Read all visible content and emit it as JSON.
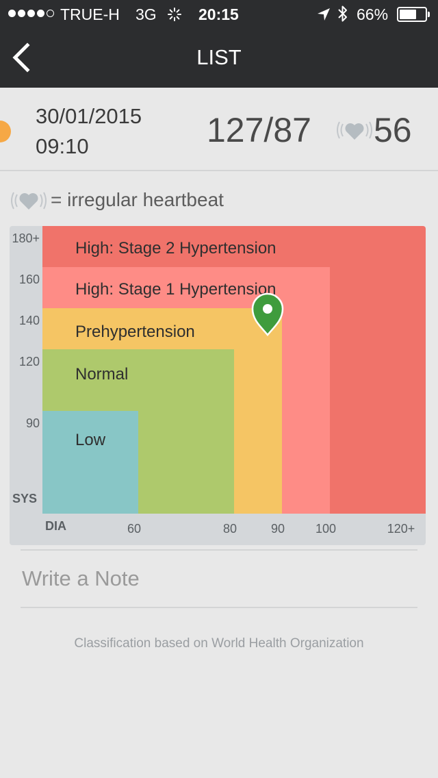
{
  "status_bar": {
    "signal_bars_filled": 4,
    "signal_bars_total": 5,
    "carrier": "TRUE-H",
    "network": "3G",
    "time": "20:15",
    "battery": "66%",
    "battery_level": 0.66,
    "icons": [
      "signal-dots-icon",
      "activity-spinner-icon",
      "location-arrow-icon",
      "bluetooth-icon",
      "battery-icon"
    ]
  },
  "nav": {
    "title": "LIST",
    "back_icon": "chevron-left-icon"
  },
  "reading": {
    "date": "30/01/2015",
    "time": "09:10",
    "blood_pressure": "127/87",
    "systolic": 127,
    "diastolic": 87,
    "heart_rate": "56",
    "category_color": "#f6a845",
    "irregular_heartbeat_icon": "heart-waves-icon"
  },
  "legend": {
    "icon": "heart-waves-icon",
    "text": "= irregular heartbeat"
  },
  "chart_data": {
    "type": "zone_chart",
    "x_axis_label": "DIA",
    "y_axis_label": "SYS",
    "x_ticks": [
      "60",
      "80",
      "90",
      "100",
      "120+"
    ],
    "x_tick_values": [
      60,
      80,
      90,
      100,
      120
    ],
    "y_ticks": [
      "180+",
      "160",
      "140",
      "120",
      "90"
    ],
    "y_tick_values": [
      180,
      160,
      140,
      120,
      90
    ],
    "zones": [
      {
        "name": "High: Stage 2 Hypertension",
        "max_dia": 120,
        "max_sys": 180,
        "color": "#f0736a"
      },
      {
        "name": "High: Stage 1 Hypertension",
        "max_dia": 100,
        "max_sys": 160,
        "color": "#fe8c86"
      },
      {
        "name": "Prehypertension",
        "max_dia": 90,
        "max_sys": 140,
        "color": "#f5c564"
      },
      {
        "name": "Normal",
        "max_dia": 80,
        "max_sys": 120,
        "color": "#aec96c"
      },
      {
        "name": "Low",
        "max_dia": 60,
        "max_sys": 90,
        "color": "#88c6c6"
      }
    ],
    "marker": {
      "dia": 87,
      "sys": 137,
      "color": "#3f9c3d",
      "icon": "map-pin-icon"
    }
  },
  "note": {
    "placeholder": "Write a Note",
    "value": ""
  },
  "footer": {
    "text": "Classification based on World Health Organization"
  }
}
